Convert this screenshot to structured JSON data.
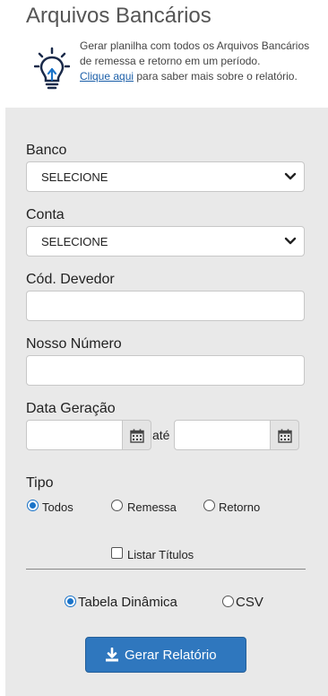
{
  "header": {
    "title": "Arquivos Bancários",
    "description": "Gerar planilha com todos os Arquivos Bancários de remessa e retorno em um período.",
    "link_text": "Clique aqui",
    "link_suffix": " para saber mais sobre o relatório.",
    "icon": "lightbulb-icon"
  },
  "form": {
    "banco_label": "Banco",
    "banco_value": "SELECIONE",
    "conta_label": "Conta",
    "conta_value": "SELECIONE",
    "cod_devedor_label": "Cód. Devedor",
    "cod_devedor_value": "",
    "nosso_numero_label": "Nosso Número",
    "nosso_numero_value": "",
    "data_geracao_label": "Data Geração",
    "data_inicio_value": "",
    "data_fim_value": "",
    "ate_label": "até",
    "tipo_label": "Tipo",
    "tipo_options": [
      "Todos",
      "Remessa",
      "Retorno"
    ],
    "tipo_selected": "Todos",
    "listar_titulos_label": "Listar Títulos",
    "listar_titulos_checked": false,
    "formato_options": [
      "Tabela Dinâmica",
      "CSV"
    ],
    "formato_selected": "Tabela Dinâmica",
    "submit_label": "Gerar Relatório"
  },
  "colors": {
    "accent": "#2f77be",
    "panel_bg": "#e9e9e9",
    "link": "#1a5ea8"
  }
}
